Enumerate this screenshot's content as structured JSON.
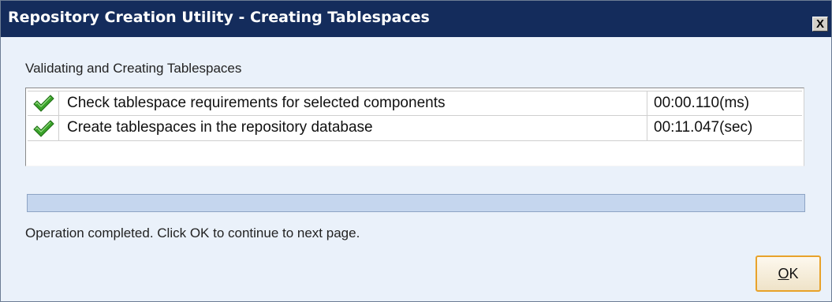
{
  "window": {
    "title": "Repository Creation Utility - Creating Tablespaces",
    "close_label": "X"
  },
  "section_label": "Validating and Creating Tablespaces",
  "tasks": [
    {
      "status_icon": "green-checkmark-icon",
      "name": "Check tablespace requirements for selected components",
      "duration": "00:00.110(ms)"
    },
    {
      "status_icon": "green-checkmark-icon",
      "name": "Create tablespaces in the repository database",
      "duration": "00:11.047(sec)"
    }
  ],
  "progress": {
    "fraction": 1.0
  },
  "status_message": "Operation completed. Click OK to continue to next page.",
  "ok_button": {
    "mnemonic": "O",
    "rest": "K"
  },
  "colors": {
    "title_bar": "#142c5c",
    "dialog_background": "#eaf1fa",
    "progress_fill": "#c5d6ee",
    "check_green": "#3aa22a",
    "ok_border": "#e8a22a"
  }
}
